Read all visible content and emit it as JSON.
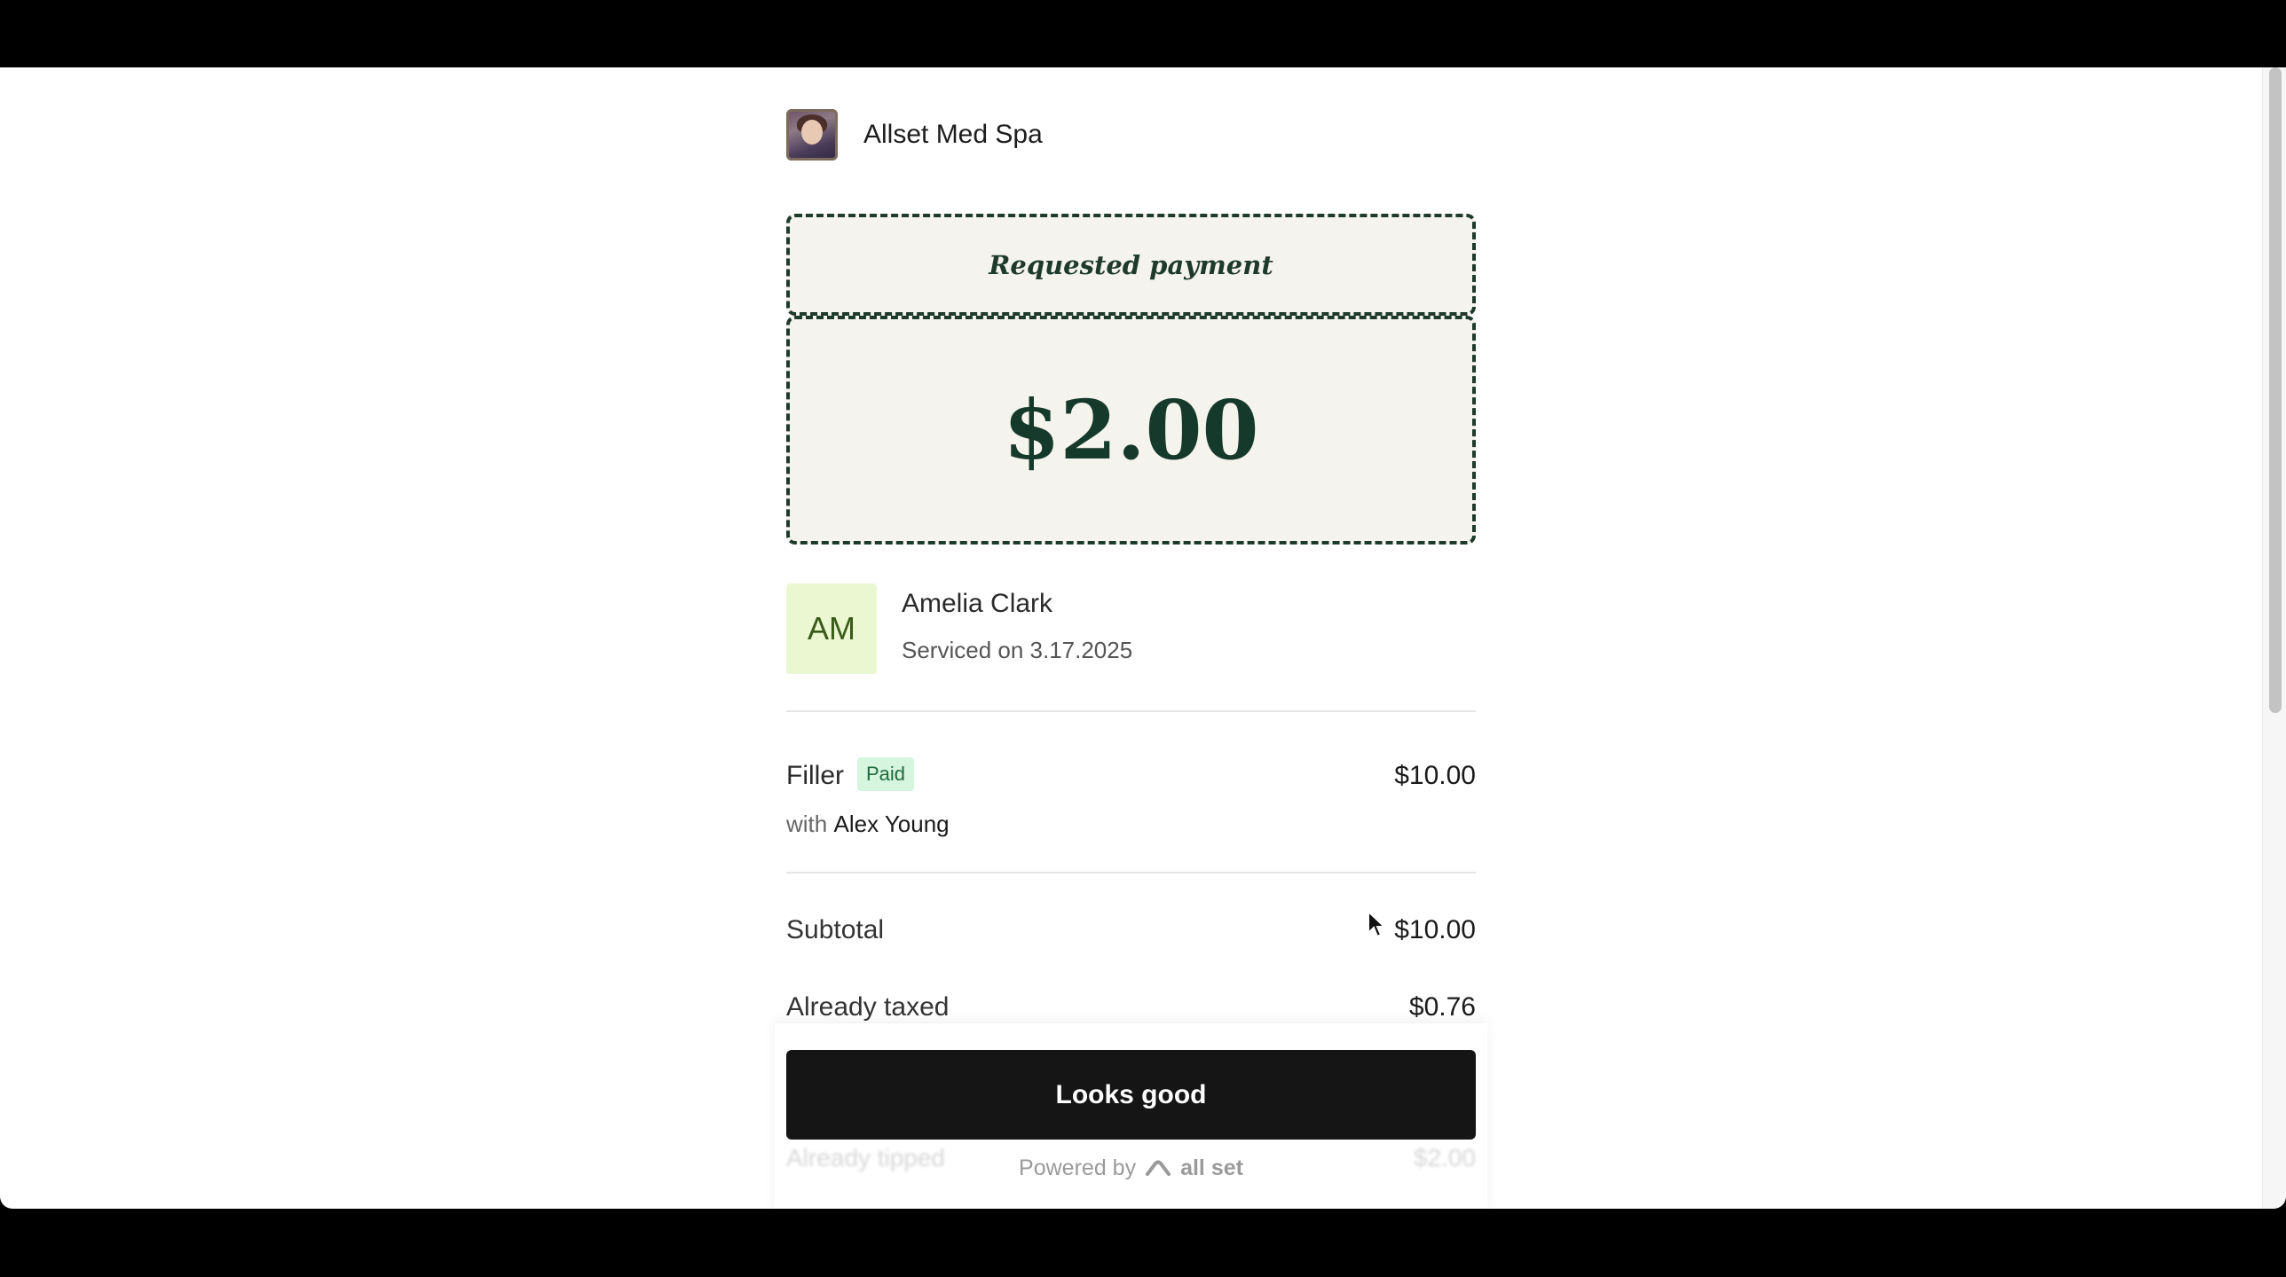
{
  "business": {
    "name": "Allset Med Spa"
  },
  "payment": {
    "label": "Requested payment",
    "amount": "$2.00"
  },
  "client": {
    "initials": "AM",
    "name": "Amelia Clark",
    "service_date": "Serviced on 3.17.2025"
  },
  "line_item": {
    "name": "Filler",
    "status": "Paid",
    "price": "$10.00",
    "with_prefix": "with",
    "provider": "Alex Young"
  },
  "summary": {
    "subtotal_label": "Subtotal",
    "subtotal_value": "$10.00",
    "taxed_label": "Already taxed",
    "taxed_value": "$0.76",
    "tipped_label": "Already tipped",
    "tipped_value": "$2.00"
  },
  "cta": {
    "label": "Looks good"
  },
  "footer": {
    "powered_by": "Powered by",
    "brand": "all set"
  },
  "colors": {
    "accent_dark_green": "#1e3a2d",
    "panel_bg": "#f5f3ee",
    "paid_badge_bg": "#d6f5df",
    "avatar_bg": "#eaf7d0",
    "button_bg": "#151515"
  }
}
